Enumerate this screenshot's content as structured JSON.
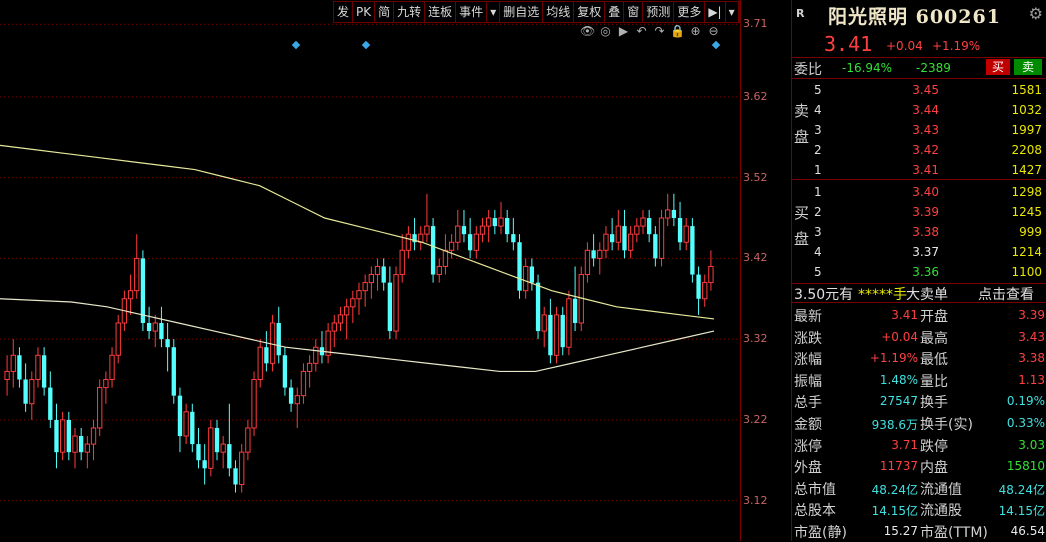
{
  "toolbar": [
    "发",
    "PK",
    "简",
    "九转",
    "连板",
    "事件",
    "▾",
    "删自选",
    "均线",
    "复权",
    "叠",
    "窗",
    "预测",
    "更多",
    "▶|",
    "▾"
  ],
  "chart_tools": [
    "eye-icon",
    "lock-alt-icon",
    "play-icon",
    "undo-icon",
    "redo-icon",
    "lock-icon",
    "zoom-in-icon",
    "zoom-out-icon"
  ],
  "chart_data": {
    "type": "candlestick",
    "ylim": [
      3.07,
      3.74
    ],
    "yticks": [
      "3.71",
      "3.62",
      "3.52",
      "3.42",
      "3.32",
      "3.22",
      "3.12"
    ],
    "ytick_values": [
      3.71,
      3.62,
      3.52,
      3.42,
      3.32,
      3.22,
      3.12
    ],
    "candles": [
      {
        "o": 3.27,
        "h": 3.3,
        "l": 3.25,
        "c": 3.28
      },
      {
        "o": 3.28,
        "h": 3.32,
        "l": 3.26,
        "c": 3.3
      },
      {
        "o": 3.3,
        "h": 3.31,
        "l": 3.26,
        "c": 3.27
      },
      {
        "o": 3.27,
        "h": 3.29,
        "l": 3.23,
        "c": 3.24
      },
      {
        "o": 3.24,
        "h": 3.28,
        "l": 3.22,
        "c": 3.27
      },
      {
        "o": 3.27,
        "h": 3.31,
        "l": 3.26,
        "c": 3.3
      },
      {
        "o": 3.3,
        "h": 3.31,
        "l": 3.25,
        "c": 3.26
      },
      {
        "o": 3.26,
        "h": 3.28,
        "l": 3.21,
        "c": 3.22
      },
      {
        "o": 3.22,
        "h": 3.24,
        "l": 3.16,
        "c": 3.18
      },
      {
        "o": 3.18,
        "h": 3.23,
        "l": 3.17,
        "c": 3.22
      },
      {
        "o": 3.22,
        "h": 3.23,
        "l": 3.17,
        "c": 3.18
      },
      {
        "o": 3.18,
        "h": 3.21,
        "l": 3.16,
        "c": 3.2
      },
      {
        "o": 3.2,
        "h": 3.21,
        "l": 3.17,
        "c": 3.18
      },
      {
        "o": 3.18,
        "h": 3.2,
        "l": 3.16,
        "c": 3.19
      },
      {
        "o": 3.19,
        "h": 3.22,
        "l": 3.17,
        "c": 3.21
      },
      {
        "o": 3.21,
        "h": 3.27,
        "l": 3.2,
        "c": 3.26
      },
      {
        "o": 3.26,
        "h": 3.28,
        "l": 3.24,
        "c": 3.27
      },
      {
        "o": 3.27,
        "h": 3.31,
        "l": 3.26,
        "c": 3.3
      },
      {
        "o": 3.3,
        "h": 3.35,
        "l": 3.29,
        "c": 3.34
      },
      {
        "o": 3.34,
        "h": 3.38,
        "l": 3.33,
        "c": 3.37
      },
      {
        "o": 3.37,
        "h": 3.4,
        "l": 3.35,
        "c": 3.38
      },
      {
        "o": 3.38,
        "h": 3.45,
        "l": 3.37,
        "c": 3.42
      },
      {
        "o": 3.42,
        "h": 3.43,
        "l": 3.33,
        "c": 3.34
      },
      {
        "o": 3.34,
        "h": 3.36,
        "l": 3.32,
        "c": 3.33
      },
      {
        "o": 3.33,
        "h": 3.35,
        "l": 3.31,
        "c": 3.34
      },
      {
        "o": 3.34,
        "h": 3.36,
        "l": 3.31,
        "c": 3.32
      },
      {
        "o": 3.32,
        "h": 3.34,
        "l": 3.28,
        "c": 3.31
      },
      {
        "o": 3.31,
        "h": 3.32,
        "l": 3.24,
        "c": 3.25
      },
      {
        "o": 3.25,
        "h": 3.26,
        "l": 3.18,
        "c": 3.2
      },
      {
        "o": 3.2,
        "h": 3.24,
        "l": 3.19,
        "c": 3.23
      },
      {
        "o": 3.23,
        "h": 3.24,
        "l": 3.18,
        "c": 3.19
      },
      {
        "o": 3.19,
        "h": 3.21,
        "l": 3.16,
        "c": 3.17
      },
      {
        "o": 3.17,
        "h": 3.19,
        "l": 3.14,
        "c": 3.16
      },
      {
        "o": 3.16,
        "h": 3.22,
        "l": 3.15,
        "c": 3.21
      },
      {
        "o": 3.21,
        "h": 3.22,
        "l": 3.17,
        "c": 3.18
      },
      {
        "o": 3.18,
        "h": 3.2,
        "l": 3.16,
        "c": 3.19
      },
      {
        "o": 3.19,
        "h": 3.24,
        "l": 3.15,
        "c": 3.16
      },
      {
        "o": 3.16,
        "h": 3.17,
        "l": 3.13,
        "c": 3.14
      },
      {
        "o": 3.14,
        "h": 3.19,
        "l": 3.13,
        "c": 3.18
      },
      {
        "o": 3.18,
        "h": 3.22,
        "l": 3.17,
        "c": 3.21
      },
      {
        "o": 3.21,
        "h": 3.28,
        "l": 3.2,
        "c": 3.27
      },
      {
        "o": 3.27,
        "h": 3.32,
        "l": 3.26,
        "c": 3.31
      },
      {
        "o": 3.31,
        "h": 3.33,
        "l": 3.28,
        "c": 3.29
      },
      {
        "o": 3.29,
        "h": 3.35,
        "l": 3.28,
        "c": 3.34
      },
      {
        "o": 3.34,
        "h": 3.36,
        "l": 3.29,
        "c": 3.3
      },
      {
        "o": 3.3,
        "h": 3.31,
        "l": 3.25,
        "c": 3.26
      },
      {
        "o": 3.26,
        "h": 3.27,
        "l": 3.23,
        "c": 3.24
      },
      {
        "o": 3.24,
        "h": 3.26,
        "l": 3.21,
        "c": 3.25
      },
      {
        "o": 3.25,
        "h": 3.29,
        "l": 3.24,
        "c": 3.28
      },
      {
        "o": 3.28,
        "h": 3.3,
        "l": 3.26,
        "c": 3.29
      },
      {
        "o": 3.29,
        "h": 3.32,
        "l": 3.28,
        "c": 3.31
      },
      {
        "o": 3.31,
        "h": 3.33,
        "l": 3.29,
        "c": 3.3
      },
      {
        "o": 3.3,
        "h": 3.34,
        "l": 3.29,
        "c": 3.33
      },
      {
        "o": 3.33,
        "h": 3.35,
        "l": 3.31,
        "c": 3.34
      },
      {
        "o": 3.34,
        "h": 3.36,
        "l": 3.33,
        "c": 3.35
      },
      {
        "o": 3.35,
        "h": 3.37,
        "l": 3.32,
        "c": 3.36
      },
      {
        "o": 3.36,
        "h": 3.38,
        "l": 3.34,
        "c": 3.37
      },
      {
        "o": 3.37,
        "h": 3.39,
        "l": 3.35,
        "c": 3.38
      },
      {
        "o": 3.38,
        "h": 3.4,
        "l": 3.36,
        "c": 3.39
      },
      {
        "o": 3.39,
        "h": 3.41,
        "l": 3.37,
        "c": 3.4
      },
      {
        "o": 3.4,
        "h": 3.42,
        "l": 3.38,
        "c": 3.41
      },
      {
        "o": 3.41,
        "h": 3.42,
        "l": 3.38,
        "c": 3.39
      },
      {
        "o": 3.39,
        "h": 3.41,
        "l": 3.32,
        "c": 3.33
      },
      {
        "o": 3.33,
        "h": 3.41,
        "l": 3.32,
        "c": 3.4
      },
      {
        "o": 3.4,
        "h": 3.45,
        "l": 3.39,
        "c": 3.43
      },
      {
        "o": 3.43,
        "h": 3.46,
        "l": 3.42,
        "c": 3.45
      },
      {
        "o": 3.45,
        "h": 3.47,
        "l": 3.43,
        "c": 3.44
      },
      {
        "o": 3.44,
        "h": 3.46,
        "l": 3.43,
        "c": 3.45
      },
      {
        "o": 3.45,
        "h": 3.5,
        "l": 3.44,
        "c": 3.46
      },
      {
        "o": 3.46,
        "h": 3.47,
        "l": 3.39,
        "c": 3.4
      },
      {
        "o": 3.4,
        "h": 3.42,
        "l": 3.39,
        "c": 3.41
      },
      {
        "o": 3.41,
        "h": 3.45,
        "l": 3.4,
        "c": 3.43
      },
      {
        "o": 3.43,
        "h": 3.45,
        "l": 3.42,
        "c": 3.44
      },
      {
        "o": 3.44,
        "h": 3.48,
        "l": 3.43,
        "c": 3.46
      },
      {
        "o": 3.46,
        "h": 3.48,
        "l": 3.44,
        "c": 3.45
      },
      {
        "o": 3.45,
        "h": 3.47,
        "l": 3.42,
        "c": 3.43
      },
      {
        "o": 3.43,
        "h": 3.46,
        "l": 3.42,
        "c": 3.45
      },
      {
        "o": 3.45,
        "h": 3.47,
        "l": 3.44,
        "c": 3.46
      },
      {
        "o": 3.46,
        "h": 3.48,
        "l": 3.44,
        "c": 3.47
      },
      {
        "o": 3.47,
        "h": 3.48,
        "l": 3.45,
        "c": 3.46
      },
      {
        "o": 3.46,
        "h": 3.49,
        "l": 3.45,
        "c": 3.47
      },
      {
        "o": 3.47,
        "h": 3.48,
        "l": 3.44,
        "c": 3.45
      },
      {
        "o": 3.45,
        "h": 3.47,
        "l": 3.43,
        "c": 3.44
      },
      {
        "o": 3.44,
        "h": 3.45,
        "l": 3.37,
        "c": 3.38
      },
      {
        "o": 3.38,
        "h": 3.42,
        "l": 3.37,
        "c": 3.41
      },
      {
        "o": 3.41,
        "h": 3.42,
        "l": 3.38,
        "c": 3.39
      },
      {
        "o": 3.39,
        "h": 3.4,
        "l": 3.32,
        "c": 3.33
      },
      {
        "o": 3.33,
        "h": 3.36,
        "l": 3.31,
        "c": 3.35
      },
      {
        "o": 3.35,
        "h": 3.37,
        "l": 3.29,
        "c": 3.3
      },
      {
        "o": 3.3,
        "h": 3.36,
        "l": 3.29,
        "c": 3.35
      },
      {
        "o": 3.35,
        "h": 3.36,
        "l": 3.3,
        "c": 3.31
      },
      {
        "o": 3.31,
        "h": 3.38,
        "l": 3.3,
        "c": 3.37
      },
      {
        "o": 3.37,
        "h": 3.41,
        "l": 3.33,
        "c": 3.34
      },
      {
        "o": 3.34,
        "h": 3.41,
        "l": 3.33,
        "c": 3.4
      },
      {
        "o": 3.4,
        "h": 3.44,
        "l": 3.39,
        "c": 3.43
      },
      {
        "o": 3.43,
        "h": 3.45,
        "l": 3.41,
        "c": 3.42
      },
      {
        "o": 3.42,
        "h": 3.44,
        "l": 3.4,
        "c": 3.43
      },
      {
        "o": 3.43,
        "h": 3.46,
        "l": 3.42,
        "c": 3.45
      },
      {
        "o": 3.45,
        "h": 3.47,
        "l": 3.43,
        "c": 3.44
      },
      {
        "o": 3.44,
        "h": 3.48,
        "l": 3.43,
        "c": 3.46
      },
      {
        "o": 3.46,
        "h": 3.48,
        "l": 3.42,
        "c": 3.43
      },
      {
        "o": 3.43,
        "h": 3.46,
        "l": 3.42,
        "c": 3.45
      },
      {
        "o": 3.45,
        "h": 3.47,
        "l": 3.44,
        "c": 3.46
      },
      {
        "o": 3.46,
        "h": 3.48,
        "l": 3.45,
        "c": 3.47
      },
      {
        "o": 3.47,
        "h": 3.48,
        "l": 3.44,
        "c": 3.45
      },
      {
        "o": 3.45,
        "h": 3.46,
        "l": 3.41,
        "c": 3.42
      },
      {
        "o": 3.42,
        "h": 3.48,
        "l": 3.41,
        "c": 3.47
      },
      {
        "o": 3.47,
        "h": 3.5,
        "l": 3.46,
        "c": 3.48
      },
      {
        "o": 3.48,
        "h": 3.5,
        "l": 3.46,
        "c": 3.47
      },
      {
        "o": 3.47,
        "h": 3.49,
        "l": 3.43,
        "c": 3.44
      },
      {
        "o": 3.44,
        "h": 3.47,
        "l": 3.43,
        "c": 3.46
      },
      {
        "o": 3.46,
        "h": 3.47,
        "l": 3.39,
        "c": 3.4
      },
      {
        "o": 3.4,
        "h": 3.41,
        "l": 3.35,
        "c": 3.37
      },
      {
        "o": 3.37,
        "h": 3.4,
        "l": 3.36,
        "c": 3.39
      },
      {
        "o": 3.39,
        "h": 3.43,
        "l": 3.38,
        "c": 3.41
      }
    ],
    "ma_yellow": [
      3.56,
      3.555,
      3.55,
      3.545,
      3.54,
      3.535,
      3.53,
      3.52,
      3.51,
      3.49,
      3.47,
      3.46,
      3.45,
      3.44,
      3.425,
      3.41,
      3.395,
      3.38,
      3.37,
      3.36,
      3.355,
      3.35,
      3.345
    ],
    "ma_white": [
      3.37,
      3.368,
      3.366,
      3.36,
      3.35,
      3.34,
      3.33,
      3.32,
      3.31,
      3.305,
      3.3,
      3.295,
      3.29,
      3.285,
      3.28,
      3.28,
      3.29,
      3.3,
      3.31,
      3.32,
      3.33
    ],
    "markers_x": [
      0.405,
      0.5,
      0.975
    ]
  },
  "stock": {
    "badge": "R",
    "name": "阳光照明 600261",
    "price": "3.41",
    "change": "+0.04",
    "change_pct": "+1.19%"
  },
  "wei": {
    "label": "委比",
    "ratio": "-16.94%",
    "diff": "-2389",
    "buy": "买",
    "sell": "卖"
  },
  "sell_label": "卖盘",
  "buy_label": "买盘",
  "asks": [
    {
      "level": "5",
      "price": "3.45",
      "vol": "1581",
      "color": "red"
    },
    {
      "level": "4",
      "price": "3.44",
      "vol": "1032",
      "color": "red"
    },
    {
      "level": "3",
      "price": "3.43",
      "vol": "1997",
      "color": "red"
    },
    {
      "level": "2",
      "price": "3.42",
      "vol": "2208",
      "color": "red"
    },
    {
      "level": "1",
      "price": "3.41",
      "vol": "1427",
      "color": "red"
    }
  ],
  "bids": [
    {
      "level": "1",
      "price": "3.40",
      "vol": "1298",
      "color": "red"
    },
    {
      "level": "2",
      "price": "3.39",
      "vol": "1245",
      "color": "red"
    },
    {
      "level": "3",
      "price": "3.38",
      "vol": "999",
      "color": "red"
    },
    {
      "level": "4",
      "price": "3.37",
      "vol": "1214",
      "color": "white"
    },
    {
      "level": "5",
      "price": "3.36",
      "vol": "1100",
      "color": "green"
    }
  ],
  "orderline": {
    "price": "3.50元有",
    "qty": "*****手",
    "desc": "大卖单",
    "link": "点击查看"
  },
  "stats": [
    {
      "l1": "最新",
      "v1": "3.41",
      "c1": "red",
      "l2": "开盘",
      "v2": "3.39",
      "c2": "red"
    },
    {
      "l1": "涨跌",
      "v1": "+0.04",
      "c1": "red",
      "l2": "最高",
      "v2": "3.43",
      "c2": "red"
    },
    {
      "l1": "涨幅",
      "v1": "+1.19%",
      "c1": "red",
      "l2": "最低",
      "v2": "3.38",
      "c2": "red"
    },
    {
      "l1": "振幅",
      "v1": "1.48%",
      "c1": "cyan",
      "l2": "量比",
      "v2": "1.13",
      "c2": "red"
    },
    {
      "l1": "总手",
      "v1": "27547",
      "c1": "cyan",
      "l2": "换手",
      "v2": "0.19%",
      "c2": "cyan"
    },
    {
      "l1": "金额",
      "v1": "938.6万",
      "c1": "cyan",
      "l2": "换手(实)",
      "v2": "0.33%",
      "c2": "cyan"
    },
    {
      "l1": "涨停",
      "v1": "3.71",
      "c1": "red",
      "l2": "跌停",
      "v2": "3.03",
      "c2": "green"
    },
    {
      "l1": "外盘",
      "v1": "11737",
      "c1": "red",
      "l2": "内盘",
      "v2": "15810",
      "c2": "green"
    },
    {
      "l1": "总市值",
      "v1": "48.24亿",
      "c1": "cyan",
      "l2": "流通值",
      "v2": "48.24亿",
      "c2": "cyan"
    },
    {
      "l1": "总股本",
      "v1": "14.15亿",
      "c1": "cyan",
      "l2": "流通股",
      "v2": "14.15亿",
      "c2": "cyan"
    },
    {
      "l1": "市盈(静)",
      "v1": "15.27",
      "c1": "white",
      "l2": "市盈(TTM)",
      "v2": "46.54",
      "c2": "white"
    }
  ]
}
